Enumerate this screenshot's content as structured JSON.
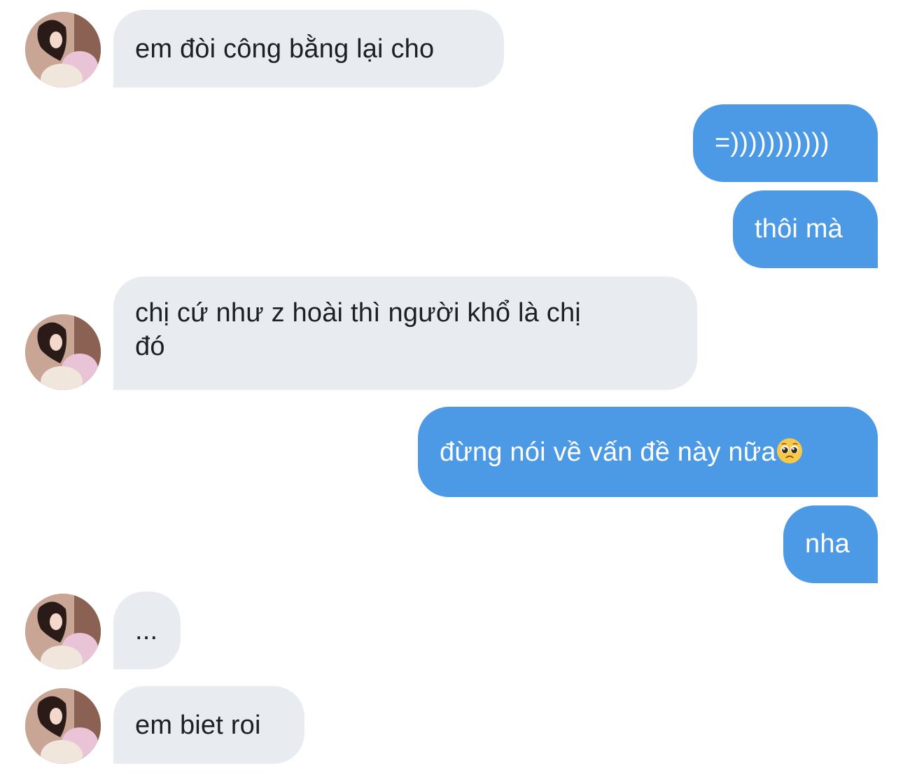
{
  "messages": [
    {
      "side": "in",
      "text": "em đòi công bằng lại cho"
    },
    {
      "side": "out",
      "text": "=)))))))))))"
    },
    {
      "side": "out",
      "text": "thôi mà"
    },
    {
      "side": "in",
      "text_line1": "chị cứ như z hoài thì người khổ là chị",
      "text_line2": "đó"
    },
    {
      "side": "out",
      "text": "đừng nói về vấn đề này nữa",
      "emoji": "pleading-face-icon"
    },
    {
      "side": "out",
      "text": "nha"
    },
    {
      "side": "in",
      "text": "..."
    },
    {
      "side": "in",
      "text": "em biet roi"
    }
  ],
  "colors": {
    "incoming_bubble": "#e8ebef",
    "outgoing_bubble": "#4c9ae6",
    "incoming_text": "#1c1f24",
    "outgoing_text": "#ffffff"
  }
}
